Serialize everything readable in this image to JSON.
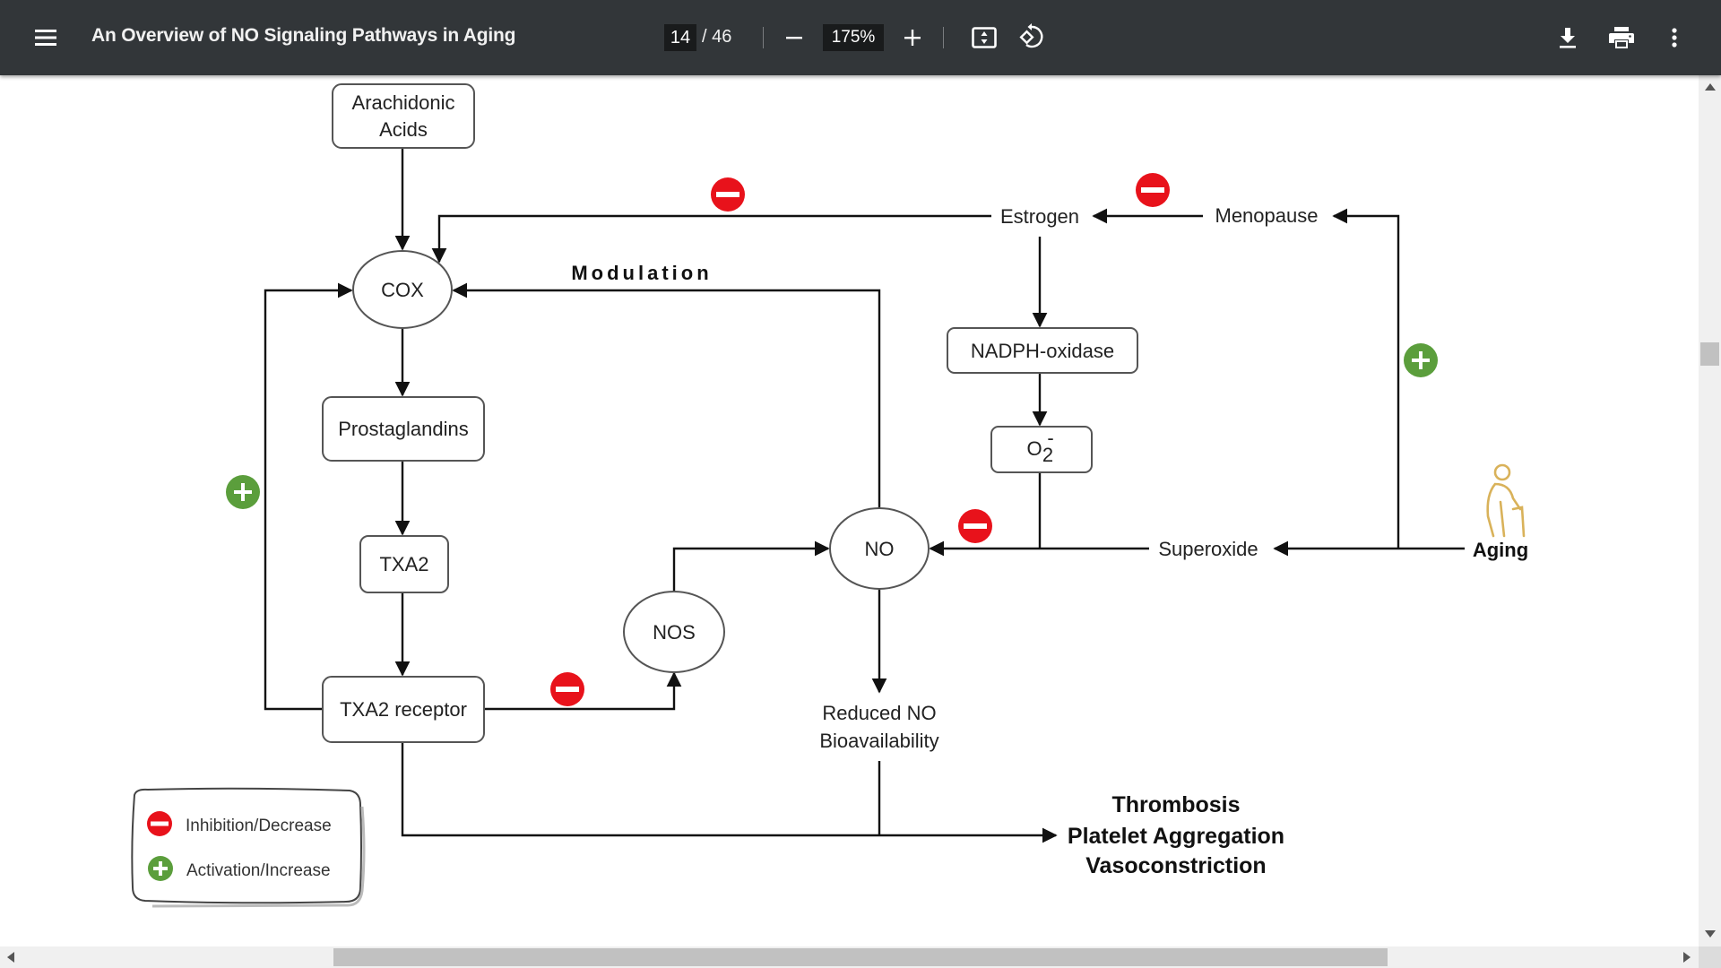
{
  "toolbar": {
    "menu_icon": "hamburger-menu-icon",
    "title": "An Overview of NO Signaling Pathways in Aging",
    "current_page": "14",
    "total_pages": "/ 46",
    "zoom_level": "175%",
    "zoom_out_icon": "minus-icon",
    "zoom_in_icon": "plus-icon",
    "fit_icon": "fit-to-page-icon",
    "rotate_icon": "rotate-counterclockwise-icon",
    "download_icon": "download-icon",
    "print_icon": "print-icon",
    "more_icon": "more-vertical-icon"
  },
  "diagram": {
    "nodes": {
      "arachidonic_line1": "Arachidonic",
      "arachidonic_line2": "Acids",
      "cox": "COX",
      "prostaglandins": "Prostaglandins",
      "txa2": "TXA2",
      "txa2_receptor": "TXA2 receptor",
      "nos": "NOS",
      "no": "NO",
      "estrogen": "Estrogen",
      "menopause": "Menopause",
      "nadph_oxidase": "NADPH-oxidase",
      "o2_base": "O",
      "o2_sub": "2",
      "o2_sup": "-",
      "superoxide": "Superoxide",
      "aging": "Aging",
      "reduced_no_line1": "Reduced NO",
      "reduced_no_line2": "Bioavailability",
      "modulation": "Modulation",
      "outcome_1": "Thrombosis",
      "outcome_2": "Platelet Aggregation",
      "outcome_3": "Vasoconstriction"
    },
    "legend": {
      "inhibition": "Inhibition/Decrease",
      "activation": "Activation/Increase"
    },
    "colors": {
      "inhibition": "#e8121b",
      "activation": "#5b9e3c",
      "aging_icon": "#d9b25a"
    }
  },
  "scrollbars": {
    "vertical_position_fraction": 0.29,
    "horizontal_position_fraction": 0.25
  }
}
